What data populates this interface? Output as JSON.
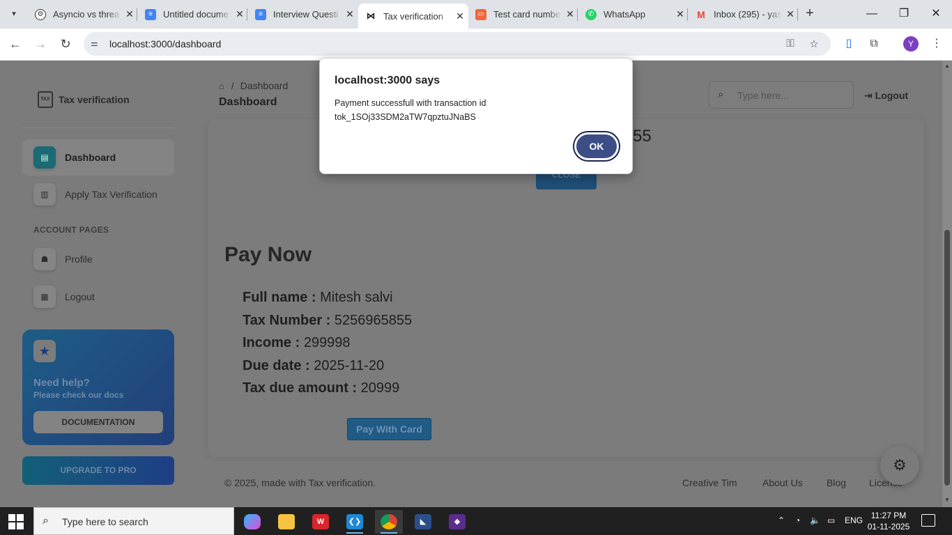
{
  "browser": {
    "tabs": [
      {
        "title": "Asyncio vs threa",
        "icon": "openai-icon",
        "color": "#333333"
      },
      {
        "title": "Untitled docume",
        "icon": "docs-icon",
        "color": "#4285f4"
      },
      {
        "title": "Interview Questi",
        "icon": "docs-icon",
        "color": "#4285f4"
      },
      {
        "title": "Tax verification",
        "icon": "bowtie-icon",
        "color": "#111111"
      },
      {
        "title": "Test card numbe",
        "icon": "stripe-docs-icon",
        "color": "#f4643a"
      },
      {
        "title": "WhatsApp",
        "icon": "whatsapp-icon",
        "color": "#25d366"
      },
      {
        "title": "Inbox (295) - yas",
        "icon": "gmail-icon",
        "color": "#ea4335"
      }
    ],
    "url": "localhost:3000/dashboard",
    "profile_initial": "Y"
  },
  "sidebar": {
    "brand": "Tax verification",
    "brand_logo_text": "TAX",
    "items": [
      {
        "label": "Dashboard",
        "icon": "store-icon"
      },
      {
        "label": "Apply Tax Verification",
        "icon": "building-icon"
      }
    ],
    "section_label": "ACCOUNT PAGES",
    "account_items": [
      {
        "label": "Profile",
        "icon": "user-icon"
      },
      {
        "label": "Logout",
        "icon": "document-icon"
      }
    ],
    "help": {
      "title": "Need help?",
      "subtitle": "Please check our docs",
      "button": "DOCUMENTATION"
    },
    "upgrade": "UPGRADE TO PRO"
  },
  "header": {
    "breadcrumb": "Dashboard",
    "title": "Dashboard",
    "search_placeholder": "Type here...",
    "logout": "Logout"
  },
  "main": {
    "partial_number": "55",
    "close_button": "CLOSE",
    "pay_title": "Pay Now",
    "fields": [
      {
        "key": "Full name :",
        "value": "Mitesh salvi"
      },
      {
        "key": "Tax Number :",
        "value": "5256965855"
      },
      {
        "key": "Income :",
        "value": "299998"
      },
      {
        "key": "Due date :",
        "value": "2025-11-20"
      },
      {
        "key": "Tax due amount :",
        "value": "20999"
      }
    ],
    "pay_button": "Pay With Card"
  },
  "footer": {
    "copyright": "© 2025, made with Tax verification.",
    "links": [
      "Creative Tim",
      "About Us",
      "Blog",
      "License"
    ]
  },
  "dialog": {
    "title": "localhost:3000 says",
    "message": "Payment successfull with transaction id tok_1SOj33SDM2aTW7qpztuJNaBS",
    "ok": "OK"
  },
  "taskbar": {
    "search_placeholder": "Type here to search",
    "language": "ENG",
    "time": "11:27 PM",
    "date": "01-11-2025"
  }
}
